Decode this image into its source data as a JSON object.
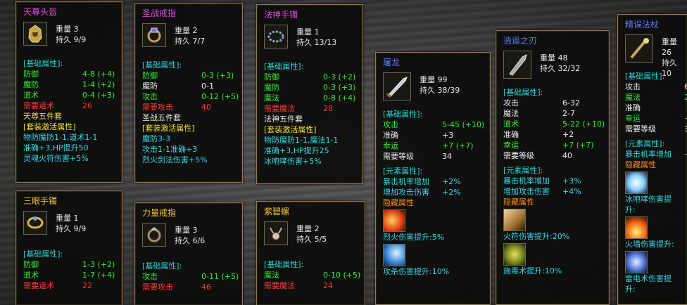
{
  "labels": {
    "weight": "重量",
    "durability": "持久",
    "base_attr": "[基础属性]:",
    "set_attr": "[套装激活属性]",
    "element_attr": "[元素属性]:",
    "hidden_attr": "隐藏属性"
  },
  "p1": {
    "title": "天尊头盔",
    "weight": "3",
    "dur": "9/9",
    "rows": [
      [
        "防御",
        "4-8 (+4)"
      ],
      [
        "魔防",
        "1-4 (+2)"
      ],
      [
        "道术",
        "0-4 (+3)"
      ],
      [
        "需要道术",
        "26"
      ]
    ],
    "set_name": "天尊五件套",
    "set_lines": [
      "物防魔防1-1,道术1-1",
      "准确+3,HP提升50",
      "灵魂火符伤害+5%"
    ]
  },
  "p2": {
    "title": "圣战戒指",
    "weight": "2",
    "dur": "7/7",
    "rows": [
      [
        "防御",
        "0-3 (+3)"
      ],
      [
        "魔防",
        "0-1"
      ],
      [
        "攻击",
        "0-12 (+5)"
      ],
      [
        "需要攻击",
        "40"
      ]
    ],
    "set_name": "圣战五件套",
    "set_lines": [
      "魔防3-3",
      "攻击1-1准确+3",
      "烈火剑法伤害+5%"
    ]
  },
  "p3": {
    "title": "法神手镯",
    "weight": "1",
    "dur": "13/13",
    "rows": [
      [
        "防御",
        "0-3 (+2)"
      ],
      [
        "魔防",
        "0-3 (+3)"
      ],
      [
        "魔法",
        "0-8 (+4)"
      ],
      [
        "需要魔法",
        "28"
      ]
    ],
    "set_name": "法神五件套",
    "set_lines": [
      "物防魔防1-1,魔法1-1",
      "准确+3,HP提升25",
      "冰咆哮伤害+5%"
    ]
  },
  "p4": {
    "title": "屠龙",
    "weight": "99",
    "dur": "38/39",
    "rows": [
      [
        "攻击",
        "5-45 (+10)"
      ],
      [
        "准确",
        "+3"
      ],
      [
        "幸运",
        "+7 (+7)"
      ],
      [
        "需要等级",
        "34"
      ]
    ],
    "elem": [
      [
        "暴击机率增加",
        "+2%"
      ],
      [
        "增加攻击伤害",
        "+2%"
      ]
    ],
    "skills": [
      "烈火伤害提升:5%",
      "攻杀伤害提升:10%"
    ]
  },
  "p5": {
    "title": "逍遥之刃",
    "weight": "48",
    "dur": "32/32",
    "rows": [
      [
        "攻击",
        "6-32"
      ],
      [
        "魔法",
        "2-7"
      ],
      [
        "道术",
        "5-22 (+10)"
      ],
      [
        "准确",
        "+2"
      ],
      [
        "幸运",
        "+7 (+7)"
      ],
      [
        "需要等级",
        "40"
      ]
    ],
    "elem": [
      [
        "暴击机率增加",
        "+3%"
      ],
      [
        "增加攻击伤害",
        "+4%"
      ]
    ],
    "skills": [
      "火符伤害提升:20%",
      "施毒术提升:10%"
    ]
  },
  "p6": {
    "title": "精误法杖",
    "weight": "26",
    "dur": "10",
    "rows": [
      [
        "攻击",
        "6"
      ],
      [
        "魔法",
        "2"
      ],
      [
        "准确",
        ""
      ],
      [
        "幸运",
        "+"
      ],
      [
        "需要等级",
        "3"
      ]
    ],
    "elem": [
      [
        "暴击机率增加",
        "+"
      ]
    ],
    "skills": [
      "冰咆哮伤害提升:",
      "火墙伤害提升:",
      "雷电术伤害提升:"
    ]
  },
  "p7": {
    "title": "三眼手镯",
    "weight": "1",
    "dur": "9/9",
    "rows": [
      [
        "防御",
        "1-3 (+2)"
      ],
      [
        "道术",
        "1-7 (+4)"
      ],
      [
        "需要道术",
        "22"
      ]
    ]
  },
  "p8": {
    "title": "力量戒指",
    "weight": "3",
    "dur": "6/6",
    "rows": [
      [
        "攻击",
        "0-11 (+5)"
      ],
      [
        "需要攻击",
        "46"
      ]
    ]
  },
  "p9": {
    "title": "紫碧螺",
    "weight": "2",
    "dur": "5/5",
    "rows": [
      [
        "魔法",
        "0-10 (+5)"
      ],
      [
        "需要魔法",
        "24"
      ]
    ]
  }
}
